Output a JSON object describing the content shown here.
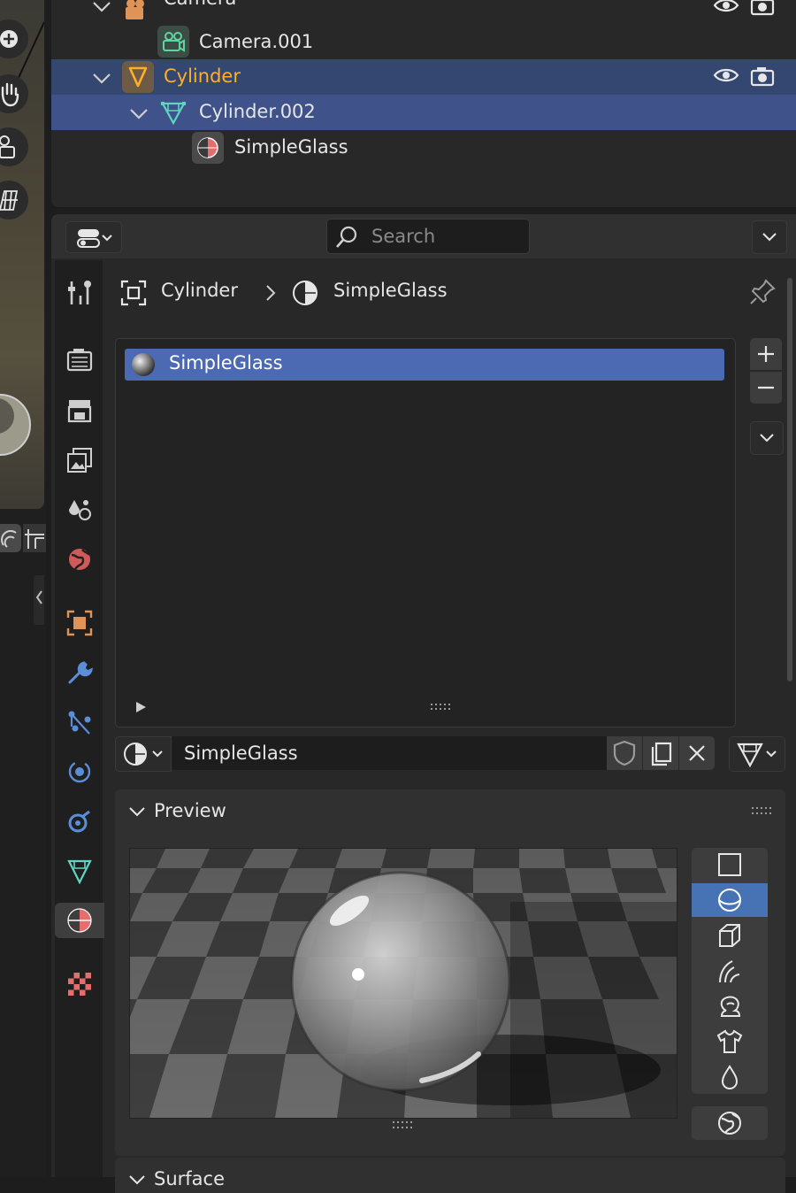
{
  "outliner": {
    "rows": [
      {
        "label": "Camera",
        "kind": "object"
      },
      {
        "label": "Camera.001",
        "kind": "camera-data"
      },
      {
        "label": "Cylinder",
        "kind": "object"
      },
      {
        "label": "Cylinder.002",
        "kind": "mesh-data"
      },
      {
        "label": "SimpleGlass",
        "kind": "material"
      }
    ]
  },
  "props": {
    "search_placeholder": "Search",
    "breadcrumb": {
      "object": "Cylinder",
      "material": "SimpleGlass"
    },
    "material_slots": [
      {
        "name": "SimpleGlass",
        "selected": true
      }
    ],
    "datablock_name": "SimpleGlass",
    "preview_panel": {
      "title": "Preview"
    },
    "next_panel_title": "Surface"
  },
  "colors": {
    "selected_object": "#344770",
    "selected_data": "#40528a",
    "slot_selected": "#4b6ab3",
    "object_label": "#ffaf29",
    "accent_blue": "#4772b3"
  }
}
